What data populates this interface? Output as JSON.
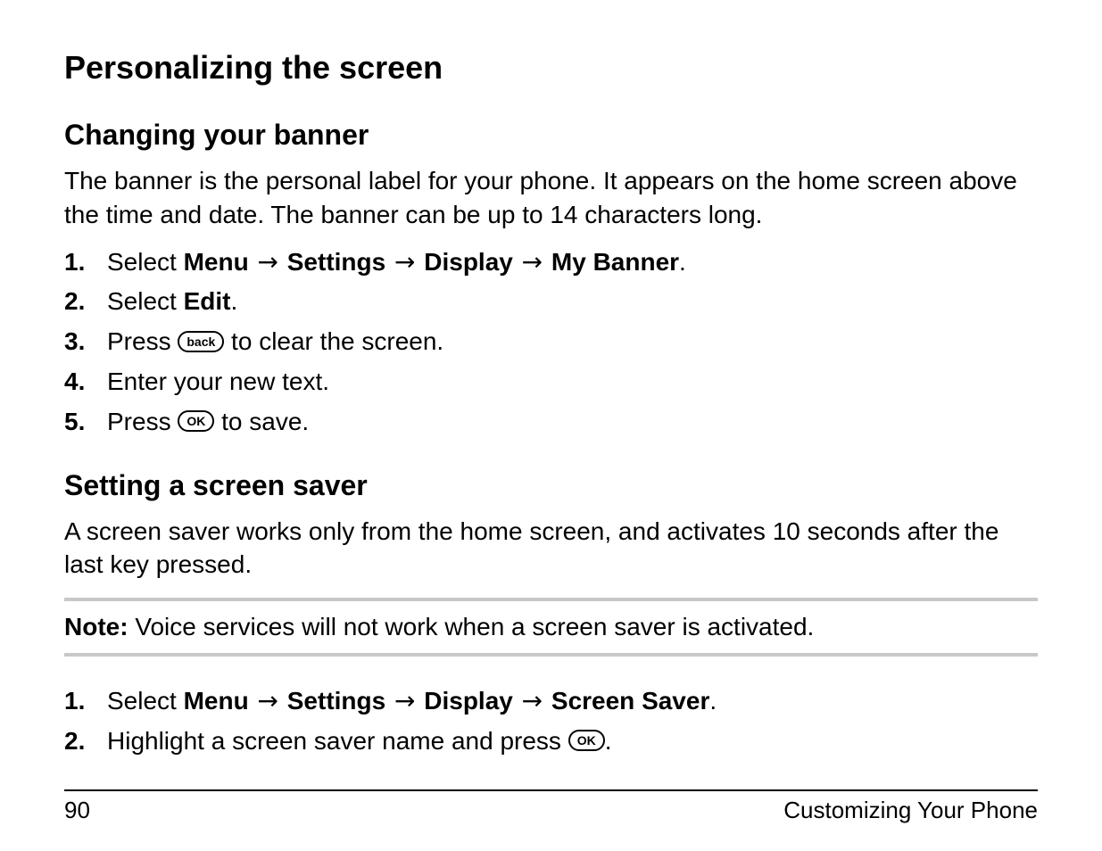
{
  "title": "Personalizing the screen",
  "section1": {
    "heading": "Changing your banner",
    "intro": "The banner is the personal label for your phone. It appears on the home screen above the time and date. The banner can be up to 14 characters long.",
    "steps": {
      "s1": {
        "num": "1.",
        "pre": "Select ",
        "path": {
          "a": "Menu",
          "b": "Settings",
          "c": "Display",
          "d": "My Banner"
        },
        "post": "."
      },
      "s2": {
        "num": "2.",
        "pre": "Select ",
        "bold": "Edit",
        "post": "."
      },
      "s3": {
        "num": "3.",
        "pre": "Press ",
        "button": "back",
        "post": " to clear the screen."
      },
      "s4": {
        "num": "4.",
        "text": "Enter your new text."
      },
      "s5": {
        "num": "5.",
        "pre": "Press ",
        "button": "OK",
        "post": " to save."
      }
    }
  },
  "section2": {
    "heading": "Setting a screen saver",
    "intro": "A screen saver works only from the home screen, and activates 10 seconds after the last key pressed.",
    "note": {
      "label": "Note:",
      "text": " Voice services will not work when a screen saver is activated."
    },
    "steps": {
      "s1": {
        "num": "1.",
        "pre": "Select ",
        "path": {
          "a": "Menu",
          "b": "Settings",
          "c": "Display",
          "d": "Screen Saver"
        },
        "post": "."
      },
      "s2": {
        "num": "2.",
        "pre": "Highlight a screen saver name and press ",
        "button": "OK",
        "post": "."
      }
    }
  },
  "arrow": "→",
  "footer": {
    "page": "90",
    "chapter": "Customizing Your Phone"
  }
}
